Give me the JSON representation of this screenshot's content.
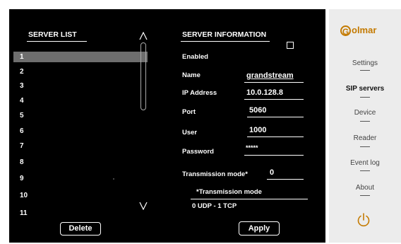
{
  "server_list": {
    "title": "SERVER LIST",
    "items": [
      "1",
      "2",
      "3",
      "4",
      "5",
      "6",
      "7",
      "8",
      "9",
      "10",
      "11"
    ],
    "selected_index": 0,
    "delete_label": "Delete"
  },
  "server_info": {
    "title": "SERVER INFORMATION",
    "enabled_label": "Enabled",
    "enabled_checked": false,
    "name_label": "Name",
    "name_value": "grandstream",
    "ip_label": "IP Address",
    "ip_value": "10.0.128.8",
    "port_label": "Port",
    "port_value": "5060",
    "user_label": "User",
    "user_value": "1000",
    "password_label": "Password",
    "password_value": "*****",
    "transmission_label": "Transmission mode*",
    "transmission_value": "0",
    "note_title": "*Transmission mode",
    "note_text": "0 UDP - 1 TCP",
    "apply_label": "Apply"
  },
  "sidebar": {
    "logo_letter": "G",
    "logo_text": "olmar",
    "menu": [
      {
        "label": "Settings",
        "active": false
      },
      {
        "label": "SIP servers",
        "active": true
      },
      {
        "label": "Device",
        "active": false
      },
      {
        "label": "Reader",
        "active": false
      },
      {
        "label": "Event log",
        "active": false
      },
      {
        "label": "About",
        "active": false
      }
    ],
    "power_icon": "power-icon"
  },
  "colors": {
    "panel_bg": "#000000",
    "sidebar_bg": "#ececec",
    "selected_row": "#6e6e6e",
    "brand": "#c47a00"
  }
}
